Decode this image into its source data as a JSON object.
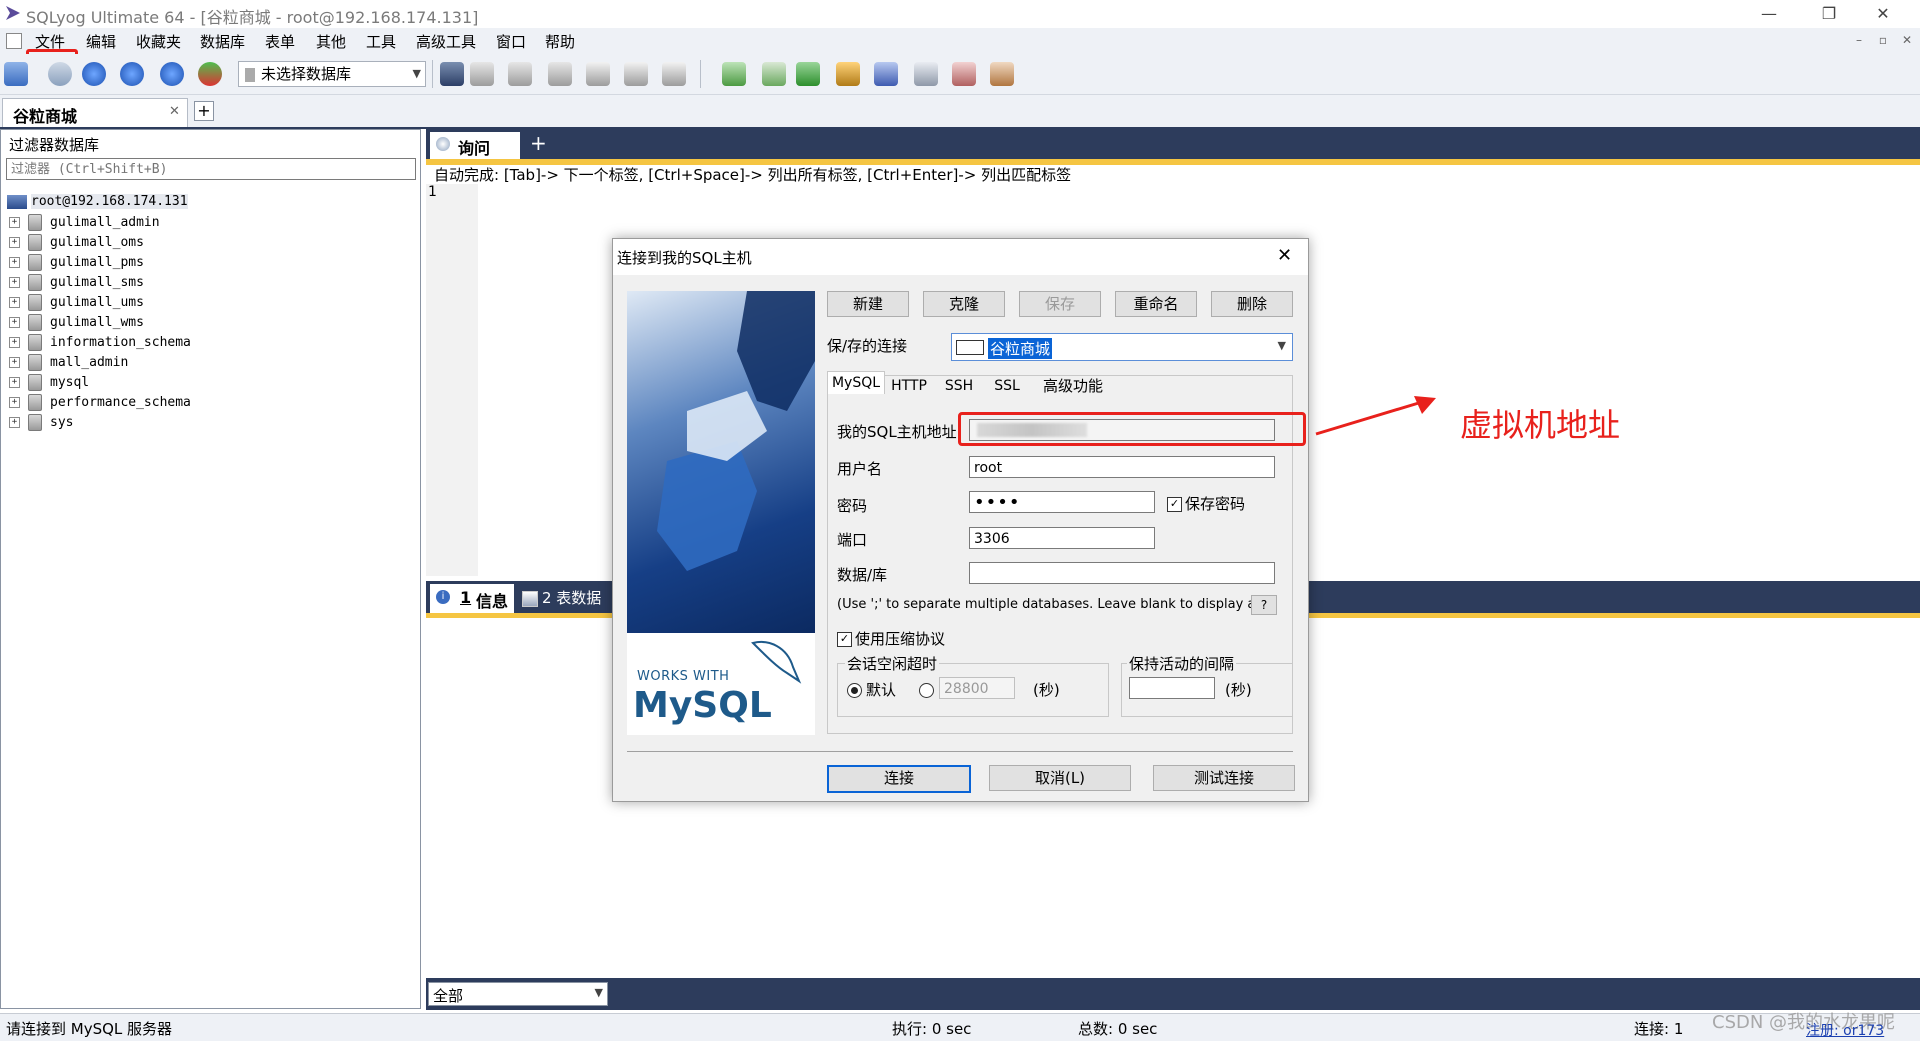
{
  "window": {
    "title": "SQLyog Ultimate 64 - [谷粒商城 - root@192.168.174.131]",
    "controls": [
      "—",
      "❐",
      "✕"
    ]
  },
  "menubar": {
    "items": [
      "文件",
      "编辑",
      "收藏夹",
      "数据库",
      "表单",
      "其他",
      "工具",
      "高级工具",
      "窗口",
      "帮助"
    ],
    "mdi_controls": [
      "–",
      "▫",
      "✕"
    ]
  },
  "toolbar": {
    "db_select": "未选择数据库"
  },
  "connection_tab": {
    "label": "谷粒商城",
    "close": "✕",
    "add": "+"
  },
  "object_browser": {
    "header": "过滤器数据库",
    "filter_placeholder": "过滤器 (Ctrl+Shift+B)",
    "root": "root@192.168.174.131",
    "databases": [
      "gulimall_admin",
      "gulimall_oms",
      "gulimall_pms",
      "gulimall_sms",
      "gulimall_ums",
      "gulimall_wms",
      "information_schema",
      "mall_admin",
      "mysql",
      "performance_schema",
      "sys"
    ]
  },
  "query": {
    "tab_label": "询问",
    "add": "+",
    "autocomplete_hint": "自动完成: [Tab]-> 下一个标签, [Ctrl+Space]-> 列出所有标签, [Ctrl+Enter]-> 列出匹配标签",
    "line_number": "1"
  },
  "results": {
    "tab1_num": "1",
    "tab1_label": "信息",
    "tab2_label": "2 表数据",
    "filter_value": "全部"
  },
  "statusbar": {
    "message": "请连接到 MySQL 服务器",
    "exec": "执行: 0 sec",
    "total": "总数: 0 sec",
    "connections": "连接: 1",
    "watermark": "CSDN @我的水龙果呢",
    "reg": "注册: or173"
  },
  "dialog": {
    "title": "连接到我的SQL主机",
    "close": "✕",
    "buttons": {
      "new": "新建",
      "clone": "克隆",
      "save": "保存",
      "rename": "重命名",
      "delete": "删除"
    },
    "saved_label": "保/存的连接",
    "saved_value": "谷粒商城",
    "tabs": [
      "MySQL",
      "HTTP",
      "SSH",
      "SSL",
      "高级功能"
    ],
    "host_label": "我的SQL主机地址",
    "host_value": "",
    "user_label": "用户名",
    "user_value": "root",
    "pass_label": "密码",
    "pass_value": "••••",
    "save_pass": "保存密码",
    "port_label": "端口",
    "port_value": "3306",
    "db_label": "数据/库",
    "db_value": "",
    "db_hint": "(Use ';' to separate multiple databases. Leave blank to display all)",
    "help_btn": "?",
    "compress": "使用压缩协议",
    "session_group": "会话空闲超时",
    "default_opt": "默认",
    "timeout_value": "28800",
    "seconds": "(秒)",
    "keepalive_group": "保持活动的间隔",
    "keepalive_value": "",
    "connect": "连接",
    "cancel": "取消(L)",
    "test": "测试连接",
    "logo_top": "WORKS WITH",
    "logo_text": "MySQL"
  },
  "annotation": {
    "label": "虚拟机地址",
    "color": "#e8211c"
  }
}
